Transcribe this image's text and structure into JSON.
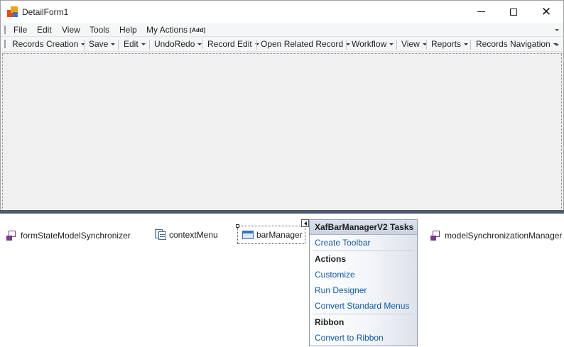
{
  "window": {
    "title": "DetailForm1",
    "minimize_glyph": "—",
    "maximize_glyph": "☐",
    "close_glyph": "✕"
  },
  "menubar": {
    "items": [
      "File",
      "Edit",
      "View",
      "Tools",
      "Help",
      "My Actions"
    ],
    "add_label": "[Add]"
  },
  "toolbar": {
    "items": [
      "Records Creation",
      "Save",
      "Edit",
      "UndoRedo",
      "Record Edit",
      "Open Related Record",
      "Workflow",
      "View",
      "Reports",
      "Records Navigation"
    ]
  },
  "tray": {
    "components": [
      "formStateModelSynchronizer",
      "contextMenu",
      "barManager",
      "modelSynchronizationManager"
    ]
  },
  "tasks_panel": {
    "title": "XafBarManagerV2 Tasks",
    "create_toolbar": "Create Toolbar",
    "actions_header": "Actions",
    "actions": [
      "Customize",
      "Run Designer",
      "Convert Standard Menus"
    ],
    "ribbon_header": "Ribbon",
    "ribbon_actions": [
      "Convert to Ribbon"
    ]
  },
  "colors": {
    "splitter": "#4e5a6c",
    "link": "#0e5aa7",
    "panel_border": "#8c99ad"
  }
}
